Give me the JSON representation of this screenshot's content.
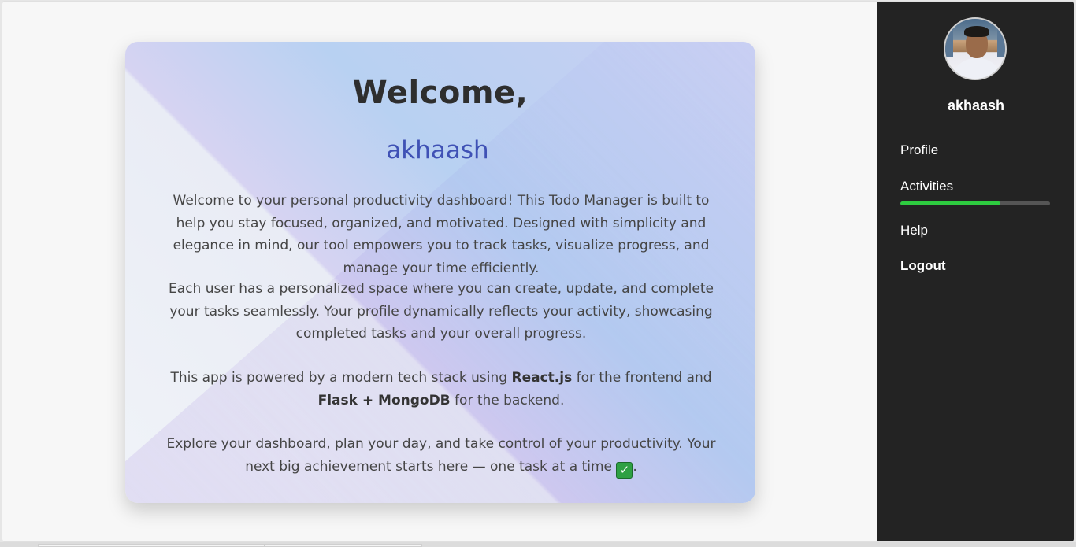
{
  "welcome": {
    "title": "Welcome,",
    "username": "akhaash",
    "p1": "Welcome to your personal productivity dashboard! This Todo Manager is built to help you stay focused, organized, and motivated. Designed with simplicity and elegance in mind, our tool empowers you to track tasks, visualize progress, and manage your time efficiently.",
    "p2": "Each user has a personalized space where you can create, update, and complete your tasks seamlessly. Your profile dynamically reflects your activity, showcasing completed tasks and your overall progress.",
    "p3_before": "This app is powered by a modern tech stack using ",
    "p3_react": "React.js",
    "p3_middle": " for the frontend and ",
    "p3_flask": "Flask + MongoDB",
    "p3_after": " for the backend.",
    "p4_text": "Explore your dashboard, plan your day, and take control of your productivity. Your next big achievement starts here — one task at a time ",
    "p4_check": "✓",
    "p4_end": "."
  },
  "sidebar": {
    "username": "akhaash",
    "links": {
      "profile": "Profile",
      "activities": "Activities",
      "help": "Help",
      "logout": "Logout"
    },
    "activity_progress": 0.67,
    "colors": {
      "background": "#232323",
      "progress_fill": "#2ecc40",
      "progress_track": "#555555"
    }
  },
  "colors": {
    "accent": "#3f51b5",
    "title": "#2e2e2e",
    "body_text": "#454545"
  }
}
